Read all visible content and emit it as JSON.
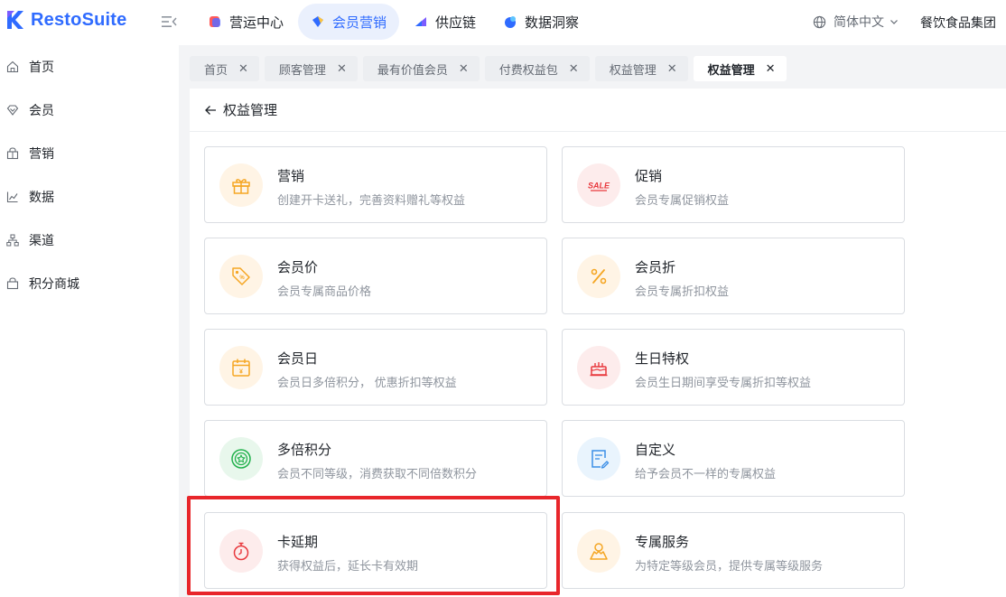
{
  "app": {
    "name": "RestoSuite"
  },
  "header": {
    "nav_tabs": [
      {
        "label": "营运中心",
        "icon": "operations-icon",
        "color": "#ff5a5a"
      },
      {
        "label": "会员营销",
        "icon": "member-marketing-icon",
        "color": "#2f6bff"
      },
      {
        "label": "供应链",
        "icon": "supply-chain-icon",
        "color": "#7b5cff"
      },
      {
        "label": "数据洞察",
        "icon": "data-insight-icon",
        "color": "#2f6bff"
      }
    ],
    "active_tab_index": 1,
    "language": "简体中文",
    "company": "餐饮食品集团"
  },
  "sidebar": {
    "items": [
      {
        "label": "首页",
        "icon": "home-icon"
      },
      {
        "label": "会员",
        "icon": "member-icon"
      },
      {
        "label": "营销",
        "icon": "marketing-icon"
      },
      {
        "label": "数据",
        "icon": "chart-icon"
      },
      {
        "label": "渠道",
        "icon": "channel-icon"
      },
      {
        "label": "积分商城",
        "icon": "points-mall-icon"
      }
    ]
  },
  "page_tabs": [
    {
      "label": "首页",
      "active": false
    },
    {
      "label": "顾客管理",
      "active": false
    },
    {
      "label": "最有价值会员",
      "active": false
    },
    {
      "label": "付费权益包",
      "active": false
    },
    {
      "label": "权益管理",
      "active": false
    },
    {
      "label": "权益管理",
      "active": true
    }
  ],
  "page": {
    "title": "权益管理",
    "cards": [
      {
        "title": "营销",
        "desc": "创建开卡送礼，完善资料赠礼等权益",
        "icon": "gift-icon",
        "bg": "#fff4e5",
        "color": "#f5a623"
      },
      {
        "title": "促销",
        "desc": "会员专属促销权益",
        "icon": "sale-icon",
        "bg": "#fdecec",
        "color": "#e8383d"
      },
      {
        "title": "会员价",
        "desc": "会员专属商品价格",
        "icon": "price-tag-icon",
        "bg": "#fff4e5",
        "color": "#f5a623"
      },
      {
        "title": "会员折",
        "desc": "会员专属折扣权益",
        "icon": "percent-icon",
        "bg": "#fff4e5",
        "color": "#f5a623"
      },
      {
        "title": "会员日",
        "desc": "会员日多倍积分， 优惠折扣等权益",
        "icon": "calendar-icon",
        "bg": "#fff4e5",
        "color": "#f5a623"
      },
      {
        "title": "生日特权",
        "desc": "会员生日期间享受专属折扣等权益",
        "icon": "cake-icon",
        "bg": "#fdecec",
        "color": "#e8383d"
      },
      {
        "title": "多倍积分",
        "desc": "会员不同等级，消费获取不同倍数积分",
        "icon": "star-medal-icon",
        "bg": "#e8f7ec",
        "color": "#22b14c"
      },
      {
        "title": "自定义",
        "desc": "给予会员不一样的专属权益",
        "icon": "edit-doc-icon",
        "bg": "#e9f4fd",
        "color": "#3a8ee6"
      },
      {
        "title": "卡延期",
        "desc": "获得权益后，延长卡有效期",
        "icon": "stopwatch-icon",
        "bg": "#fdecec",
        "color": "#e8383d"
      },
      {
        "title": "专属服务",
        "desc": "为特定等级会员，提供专属等级服务",
        "icon": "service-icon",
        "bg": "#fff4e5",
        "color": "#f5a623"
      }
    ]
  },
  "colors": {
    "brand": "#2f6bff",
    "highlight": "#e8262b"
  }
}
